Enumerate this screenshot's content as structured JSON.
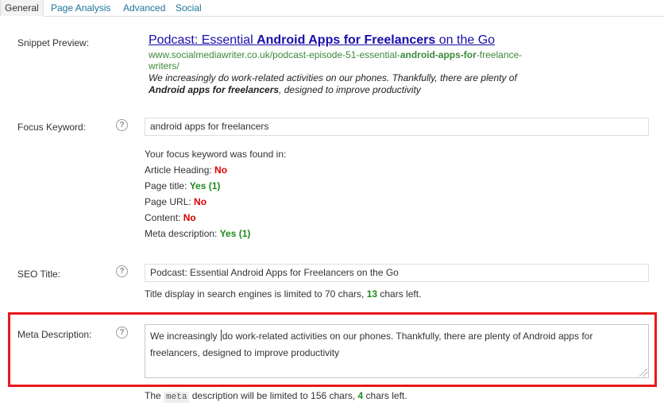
{
  "tabs": [
    {
      "label": "General",
      "active": true
    },
    {
      "label": "Page Analysis",
      "active": false
    },
    {
      "label": "Advanced",
      "active": false
    },
    {
      "label": "Social",
      "active": false
    }
  ],
  "snippet": {
    "label": "Snippet Preview:",
    "title_pre": "Podcast: Essential ",
    "title_bold": "Android Apps for Freelancers",
    "title_post": " on the Go",
    "url_pre": "www.socialmediawriter.co.uk/podcast-episode-51-essential-",
    "url_bold": "android-apps-for",
    "url_post": "-freelance-",
    "url_line2": "writers/",
    "desc_line1": "We increasingly do work-related activities on our phones. Thankfully, there are plenty of",
    "desc_bold": "Android apps for freelancers",
    "desc_post": ", designed to improve productivity"
  },
  "focus": {
    "label": "Focus Keyword:",
    "help": "?",
    "value": "android apps for freelancers",
    "found_in": "Your focus keyword was found in:",
    "checks": [
      {
        "label": "Article Heading: ",
        "result": "No",
        "ok": false
      },
      {
        "label": "Page title: ",
        "result": "Yes (1)",
        "ok": true
      },
      {
        "label": "Page URL: ",
        "result": "No",
        "ok": false
      },
      {
        "label": "Content: ",
        "result": "No",
        "ok": false
      },
      {
        "label": "Meta description: ",
        "result": "Yes (1)",
        "ok": true
      }
    ]
  },
  "seo": {
    "label": "SEO Title:",
    "help": "?",
    "value": "Podcast: Essential Android Apps for Freelancers on the Go",
    "note_pre": "Title display in search engines is limited to 70 chars, ",
    "note_count": "13",
    "note_post": " chars left."
  },
  "meta": {
    "label": "Meta Description:",
    "help": "?",
    "value_before_cursor": "We increasingly ",
    "value_after_cursor": "do work-related activities on our phones. Thankfully, there are plenty of Android apps for freelancers, designed to improve productivity",
    "note_pre": "The ",
    "note_code": "meta",
    "note_mid": " description will be limited to 156 chars, ",
    "note_count": "4",
    "note_post": " chars left."
  },
  "colors": {
    "link": "#1a0dab",
    "url": "#3c8a3c",
    "no": "#dc0000",
    "yes": "#1f8a1f",
    "highlight": "#e8191c"
  }
}
